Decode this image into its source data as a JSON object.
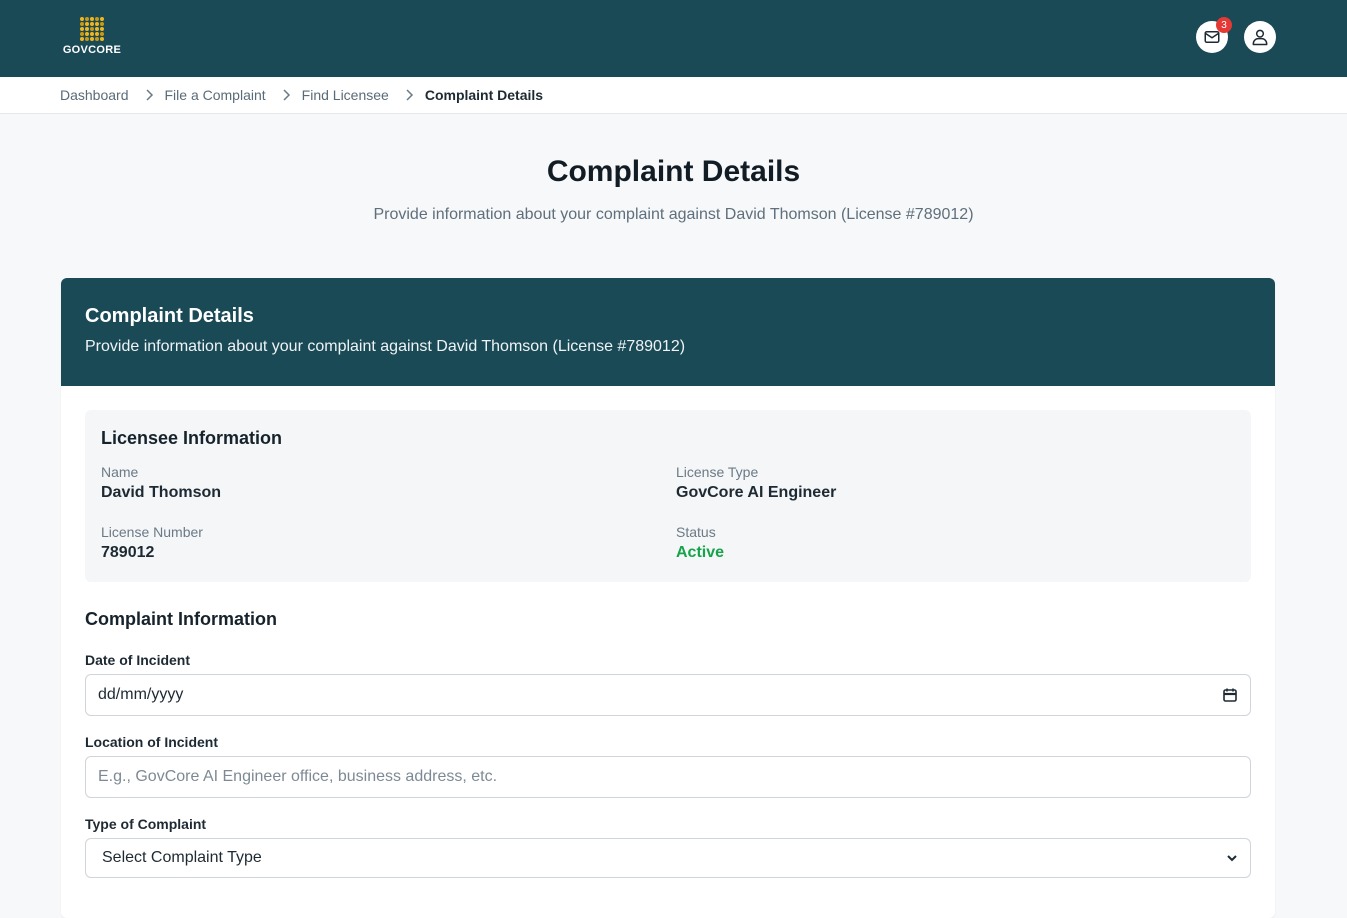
{
  "brand": {
    "name": "GOVCORE"
  },
  "header": {
    "notification_count": "3",
    "icons": {
      "mail": "mail-icon",
      "user": "user-icon"
    }
  },
  "breadcrumb": {
    "items": [
      "Dashboard",
      "File a Complaint",
      "Find Licensee"
    ],
    "current": "Complaint Details"
  },
  "page": {
    "title": "Complaint Details",
    "subtitle": "Provide information about your complaint against David Thomson (License #789012)"
  },
  "card": {
    "title": "Complaint Details",
    "subtitle": "Provide information about your complaint against David Thomson (License #789012)"
  },
  "licensee": {
    "heading": "Licensee Information",
    "name_label": "Name",
    "name": "David Thomson",
    "license_type_label": "License Type",
    "license_type": "GovCore AI Engineer",
    "license_number_label": "License Number",
    "license_number": "789012",
    "status_label": "Status",
    "status": "Active"
  },
  "complaint": {
    "heading": "Complaint Information",
    "date_label": "Date of Incident",
    "date_value": "dd/mm/yyyy",
    "location_label": "Location of Incident",
    "location_placeholder": "E.g., GovCore AI Engineer office, business address, etc.",
    "type_label": "Type of Complaint",
    "type_selected": "Select Complaint Type"
  },
  "colors": {
    "primary": "#1b4a57",
    "accent": "#f2b51c",
    "status_active": "#16a34a",
    "badge": "#e53935"
  }
}
